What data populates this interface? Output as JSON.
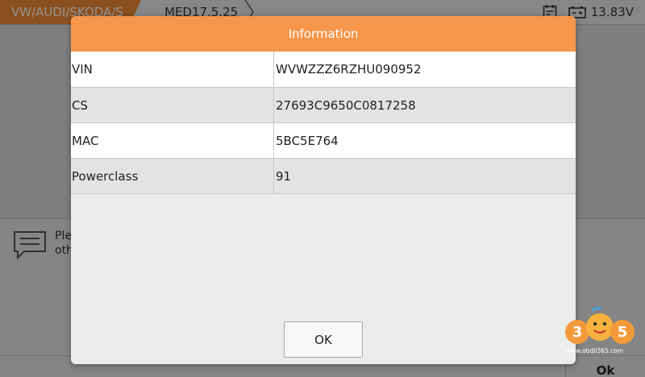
{
  "app": {
    "breadcrumb": [
      "VW/AUDI/SKODA/S",
      "MED17.5.25"
    ],
    "voltage": "13.83V",
    "message_fragment": [
      "Ple",
      "oth"
    ],
    "bg_ok_label": "Ok"
  },
  "dialog": {
    "title": "Information",
    "rows": [
      {
        "key": "VIN",
        "value": "WVWZZZ6RZHU090952"
      },
      {
        "key": "CS",
        "value": "27693C9650C0817258"
      },
      {
        "key": "MAC",
        "value": "5BC5E764"
      },
      {
        "key": "Powerclass",
        "value": "91"
      }
    ],
    "ok_label": "OK"
  },
  "watermark": {
    "text": "365",
    "url": "www.obdii365.com"
  },
  "colors": {
    "accent": "#f5964a",
    "breadcrumb_active": "#f08a36"
  },
  "icons": [
    "calendar-icon",
    "battery-icon",
    "message-icon"
  ]
}
